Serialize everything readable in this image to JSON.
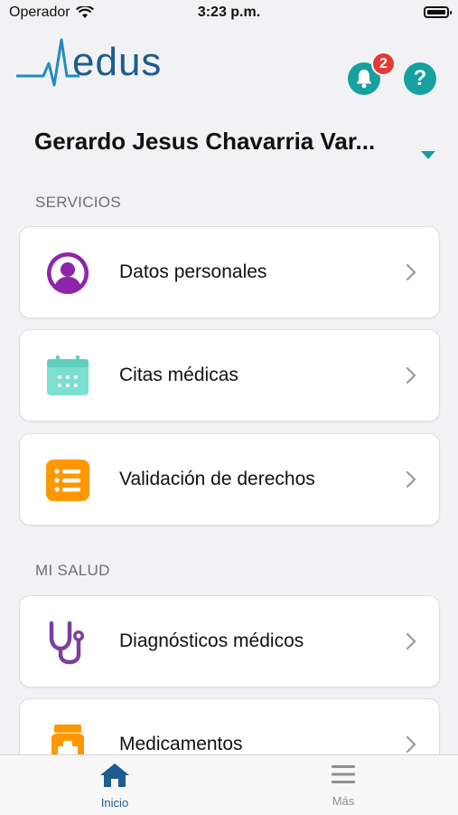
{
  "status": {
    "carrier": "Operador",
    "time": "3:23 p.m.",
    "battery_level": 1.0
  },
  "header": {
    "logo_text": "edus",
    "notification_count": "2",
    "help_symbol": "?"
  },
  "user": {
    "name": "Gerardo Jesus Chavarria Var..."
  },
  "sections": {
    "services_title": "SERVICIOS",
    "health_title": "MI SALUD"
  },
  "services": [
    {
      "label": "Datos personales",
      "icon": "user-circle-icon"
    },
    {
      "label": "Citas médicas",
      "icon": "calendar-icon"
    },
    {
      "label": "Validación de derechos",
      "icon": "list-icon"
    }
  ],
  "health": [
    {
      "label": "Diagnósticos médicos",
      "icon": "stethoscope-icon"
    },
    {
      "label": "Medicamentos",
      "icon": "pill-bottle-icon"
    }
  ],
  "tabbar": {
    "home_label": "Inicio",
    "more_label": "Más",
    "active_color": "#1f5c8f",
    "inactive_color": "#8e8e93"
  },
  "colors": {
    "accent_teal": "#16a0a0",
    "brand_blue": "#1f5c8f",
    "badge_red": "#e53935"
  }
}
